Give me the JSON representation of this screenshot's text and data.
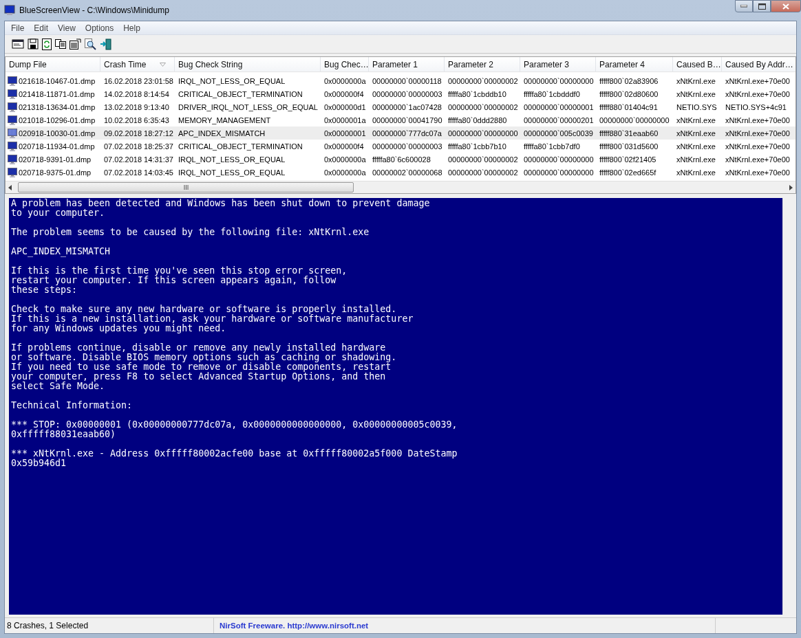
{
  "window": {
    "title": "BlueScreenView  -  C:\\Windows\\Minidump"
  },
  "menu": [
    "File",
    "Edit",
    "View",
    "Options",
    "Help"
  ],
  "toolbar": [
    {
      "kind": "properties"
    },
    {
      "kind": "save"
    },
    {
      "kind": "refresh"
    },
    {
      "kind": "copy"
    },
    {
      "kind": "options"
    },
    {
      "kind": "find"
    },
    {
      "kind": "exit"
    }
  ],
  "table": {
    "columns": [
      {
        "label": "Dump File",
        "sorted": false
      },
      {
        "label": "Crash Time",
        "sorted": true
      },
      {
        "label": "Bug Check String",
        "sorted": false
      },
      {
        "label": "Bug Chec…",
        "sorted": false
      },
      {
        "label": "Parameter 1",
        "sorted": false
      },
      {
        "label": "Parameter 2",
        "sorted": false
      },
      {
        "label": "Parameter 3",
        "sorted": false
      },
      {
        "label": "Parameter 4",
        "sorted": false
      },
      {
        "label": "Caused B…",
        "sorted": false
      },
      {
        "label": "Caused By Addr…",
        "sorted": false
      }
    ],
    "rows": [
      {
        "selected": false,
        "cells": [
          "021618-10467-01.dmp",
          "16.02.2018 23:01:58",
          "IRQL_NOT_LESS_OR_EQUAL",
          "0x0000000a",
          "00000000`00000118",
          "00000000`00000002",
          "00000000`00000000",
          "fffff800`02a83906",
          "xNtKrnl.exe",
          "xNtKrnl.exe+70e00"
        ]
      },
      {
        "selected": false,
        "cells": [
          "021418-11871-01.dmp",
          "14.02.2018 8:14:54",
          "CRITICAL_OBJECT_TERMINATION",
          "0x000000f4",
          "00000000`00000003",
          "fffffa80`1cbddb10",
          "fffffa80`1cbdddf0",
          "fffff800`02d80600",
          "xNtKrnl.exe",
          "xNtKrnl.exe+70e00"
        ]
      },
      {
        "selected": false,
        "cells": [
          "021318-13634-01.dmp",
          "13.02.2018 9:13:40",
          "DRIVER_IRQL_NOT_LESS_OR_EQUAL",
          "0x000000d1",
          "00000000`1ac07428",
          "00000000`00000002",
          "00000000`00000001",
          "fffff880`01404c91",
          "NETIO.SYS",
          "NETIO.SYS+4c91"
        ]
      },
      {
        "selected": false,
        "cells": [
          "021018-10296-01.dmp",
          "10.02.2018 6:35:43",
          "MEMORY_MANAGEMENT",
          "0x0000001a",
          "00000000`00041790",
          "fffffa80`0ddd2880",
          "00000000`00000201",
          "00000000`00000000",
          "xNtKrnl.exe",
          "xNtKrnl.exe+70e00"
        ]
      },
      {
        "selected": true,
        "cells": [
          "020918-10030-01.dmp",
          "09.02.2018 18:27:12",
          "APC_INDEX_MISMATCH",
          "0x00000001",
          "00000000`777dc07a",
          "00000000`00000000",
          "00000000`005c0039",
          "fffff880`31eaab60",
          "xNtKrnl.exe",
          "xNtKrnl.exe+70e00"
        ]
      },
      {
        "selected": false,
        "cells": [
          "020718-11934-01.dmp",
          "07.02.2018 18:25:37",
          "CRITICAL_OBJECT_TERMINATION",
          "0x000000f4",
          "00000000`00000003",
          "fffffa80`1cbb7b10",
          "fffffa80`1cbb7df0",
          "fffff800`031d5600",
          "xNtKrnl.exe",
          "xNtKrnl.exe+70e00"
        ]
      },
      {
        "selected": false,
        "cells": [
          "020718-9391-01.dmp",
          "07.02.2018 14:31:37",
          "IRQL_NOT_LESS_OR_EQUAL",
          "0x0000000a",
          "fffffa80`6c600028",
          "00000000`00000002",
          "00000000`00000000",
          "fffff800`02f21405",
          "xNtKrnl.exe",
          "xNtKrnl.exe+70e00"
        ]
      },
      {
        "selected": false,
        "cells": [
          "020718-9375-01.dmp",
          "07.02.2018 14:03:45",
          "IRQL_NOT_LESS_OR_EQUAL",
          "0x0000000a",
          "00000002`00000068",
          "00000000`00000002",
          "00000000`00000000",
          "fffff800`02ed665f",
          "xNtKrnl.exe",
          "xNtKrnl.exe+70e00"
        ]
      }
    ]
  },
  "bsod": [
    "A problem has been detected and Windows has been shut down to prevent damage\nto your computer.",
    "The problem seems to be caused by the following file: xNtKrnl.exe",
    "APC_INDEX_MISMATCH",
    "If this is the first time you've seen this stop error screen,\nrestart your computer. If this screen appears again, follow\nthese steps:",
    "Check to make sure any new hardware or software is properly installed.\nIf this is a new installation, ask your hardware or software manufacturer\nfor any Windows updates you might need.",
    "If problems continue, disable or remove any newly installed hardware\nor software. Disable BIOS memory options such as caching or shadowing.\nIf you need to use safe mode to remove or disable components, restart\nyour computer, press F8 to select Advanced Startup Options, and then\nselect Safe Mode.",
    "Technical Information:",
    "*** STOP: 0x00000001 (0x00000000777dc07a, 0x0000000000000000, 0x00000000005c0039,\n0xfffff88031eaab60)",
    "*** xNtKrnl.exe - Address 0xfffff80002acfe00 base at 0xfffff80002a5f000 DateStamp\n0x59b946d1"
  ],
  "status_bar": {
    "count": "8 Crashes, 1 Selected",
    "link": "NirSoft Freeware.  http://www.nirsoft.net"
  }
}
